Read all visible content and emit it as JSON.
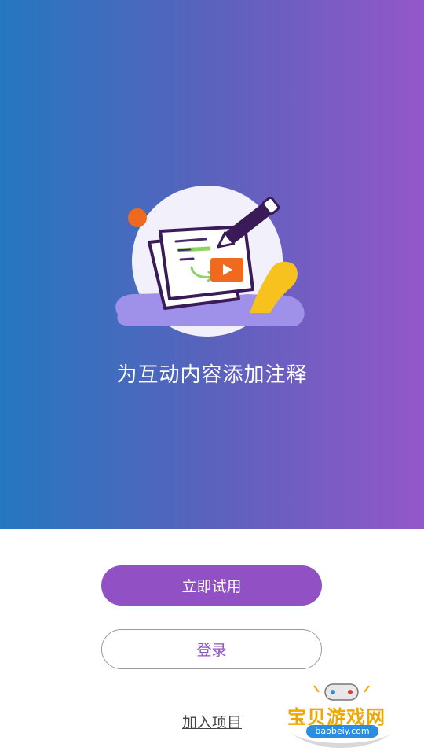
{
  "hero": {
    "tagline": "为互动内容添加注释"
  },
  "actions": {
    "try_now_label": "立即试用",
    "login_label": "登录",
    "join_project_label": "加入项目"
  },
  "watermark": {
    "title": "宝贝游戏网",
    "url": "baobeiy.com"
  },
  "colors": {
    "gradient_start": "#2577bf",
    "gradient_end": "#9457c9",
    "primary_button": "#9151c4",
    "outline_text": "#8e4fc2"
  },
  "icons": {
    "illustration": "annotate-video-illustration",
    "watermark_logo": "gamepad-icon"
  }
}
